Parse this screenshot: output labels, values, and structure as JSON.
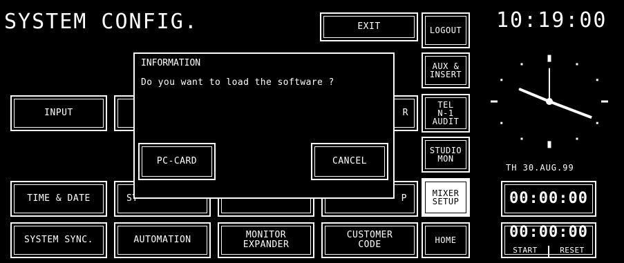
{
  "header": {
    "title": "SYSTEM CONFIG.",
    "exit_label": "EXIT"
  },
  "right_column": {
    "logout": "LOGOUT",
    "aux_insert": "AUX &\nINSERT",
    "tel_n1_audit": "TEL\nN-1\nAUDIT",
    "studio_mon": "STUDIO\nMON",
    "mixer_setup": "MIXER\nSETUP",
    "home": "HOME"
  },
  "clock": {
    "time": "10:19:00",
    "date": "TH 30.AUG.99",
    "hour_hand_angle": 120,
    "minute_hand_angle": 114
  },
  "timers": {
    "timer1": "00:00:00",
    "timer2": "00:00:00",
    "start_label": "START",
    "reset_label": "RESET"
  },
  "buttons": {
    "input": "INPUT",
    "r_partial": "R",
    "time_date": "TIME & DATE",
    "system_test_partial": "SY",
    "p_partial": "P",
    "system_sync": "SYSTEM SYNC.",
    "automation": "AUTOMATION",
    "monitor_expander": "MONITOR\nEXPANDER",
    "customer_code": "CUSTOMER\nCODE"
  },
  "dialog": {
    "title": "INFORMATION",
    "message": "Do you want to load the software ?",
    "pc_card_label": "PC-CARD",
    "cancel_label": "CANCEL"
  }
}
